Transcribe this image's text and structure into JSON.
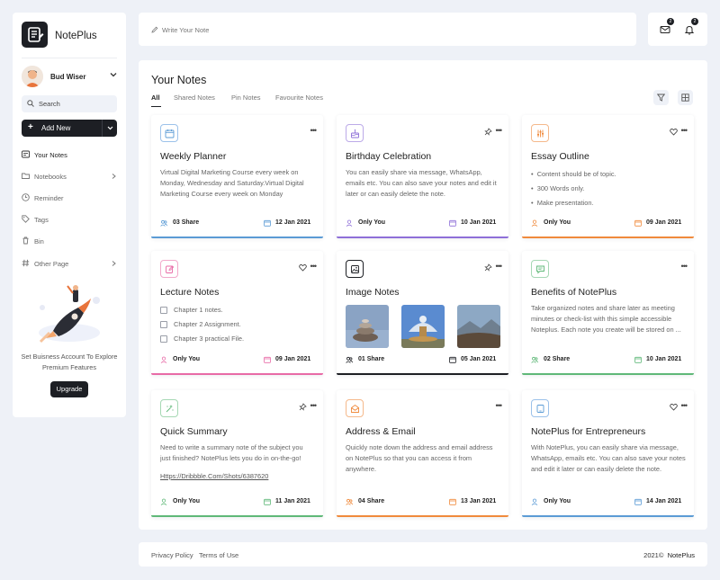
{
  "app": {
    "name": "NotePlus"
  },
  "user": {
    "name": "Bud Wiser"
  },
  "sidebar": {
    "search_placeholder": "Search",
    "add_new": "Add New",
    "nav": [
      {
        "label": "Your Notes",
        "icon": "notes-icon"
      },
      {
        "label": "Notebooks",
        "icon": "folder-icon"
      },
      {
        "label": "Reminder",
        "icon": "clock-icon"
      },
      {
        "label": "Tags",
        "icon": "tag-icon"
      },
      {
        "label": "Bin",
        "icon": "trash-icon"
      },
      {
        "label": "Other Page",
        "icon": "hash-icon"
      }
    ],
    "promo_text": "Set Buisness Account To Explore Premium Features",
    "upgrade": "Upgrade"
  },
  "topbar": {
    "note_placeholder": "Write Your Note"
  },
  "header_icons": {
    "mail_count": "2",
    "bell_count": "2"
  },
  "main": {
    "title": "Your Notes",
    "tabs": [
      "All",
      "Shared Notes",
      "Pin Notes",
      "Favourite Notes"
    ],
    "cards": [
      {
        "title": "Weekly Planner",
        "icon": "calendar-icon",
        "accent": "#5b9bd5",
        "desc": "Virtual Digital Marketing Course every week on Monday, Wednesday and Saturday.Virtual Digital Marketing Course every week on Monday",
        "footer_left": "03 Share",
        "date": "12 Jan 2021"
      },
      {
        "title": "Birthday Celebration",
        "icon": "cake-icon",
        "accent": "#8e6fd8",
        "desc": "You can easily share via message, WhatsApp, emails etc. You can also save your notes and edit it later or can easily delete the note.",
        "footer_left": "Only You",
        "date": "10 Jan 2021"
      },
      {
        "title": "Essay Outline",
        "icon": "sliders-icon",
        "accent": "#f08a3c",
        "bullets": [
          "Content should be of topic.",
          "300 Words only.",
          "Make presentation."
        ],
        "footer_left": "Only You",
        "date": "09 Jan 2021"
      },
      {
        "title": "Lecture Notes",
        "icon": "edit-icon",
        "accent": "#e86aa6",
        "checklist": [
          "Chapter 1 notes.",
          "Chapter 2 Assignment.",
          "Chapter 3 practical File."
        ],
        "footer_left": "Only You",
        "date": "09 Jan 2021"
      },
      {
        "title": "Image Notes",
        "icon": "image-icon",
        "accent": "#1d1f24",
        "footer_left": "01 Share",
        "date": "05 Jan 2021"
      },
      {
        "title": "Benefits of NotePlus",
        "icon": "chat-icon",
        "accent": "#5fb878",
        "desc": "Take organized notes and share later as meeting minutes or check-list with this simple accessible Noteplus. Each note you create will be stored on ...",
        "footer_left": "02 Share",
        "date": "10 Jan 2021"
      },
      {
        "title": "Quick Summary",
        "icon": "sparkle-icon",
        "accent": "#5fb878",
        "desc": "Need to write a summary note of the subject you just finished? NotePlus lets you do in on-the-go!",
        "link": "Https://Dribbble.Com/Shots/6387620",
        "footer_left": "Only You",
        "date": "11 Jan 2021"
      },
      {
        "title": "Address & Email",
        "icon": "mail-open-icon",
        "accent": "#f08a3c",
        "desc": "Quickly note down the address and email address on NotePlus so that you can access it from anywhere.",
        "footer_left": "04 Share",
        "date": "13 Jan 2021"
      },
      {
        "title": "NotePlus for Entrepreneurs",
        "icon": "tablet-icon",
        "accent": "#5b9bd5",
        "desc": "With NotePlus, you can easily share via message, WhatsApp, emails etc. You can also save your notes and edit it later or can easily delete the note.",
        "footer_left": "Only You",
        "date": "14 Jan 2021"
      }
    ]
  },
  "footer": {
    "privacy": "Privacy Policy",
    "terms": "Terms of Use",
    "copyright": "2021©",
    "brand": "NotePlus"
  }
}
